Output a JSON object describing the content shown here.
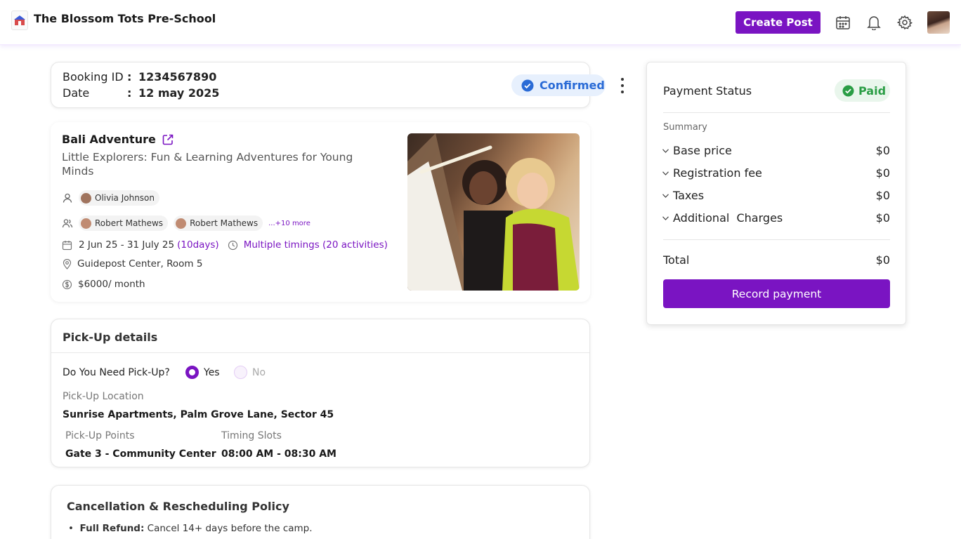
{
  "header": {
    "app_title": "The Blossom Tots Pre-School",
    "create_post_label": "Create Post"
  },
  "booking": {
    "id_label": "Booking ID",
    "id_value": "1234567890",
    "date_label": "Date",
    "date_value": "12 may 2025",
    "colon": ":",
    "status": "Confirmed"
  },
  "program": {
    "title": "Bali Adventure",
    "subtitle": "Little Explorers: Fun & Learning Adventures for Young Minds",
    "instructor": "Olivia Johnson",
    "participants": [
      "Robert Mathews",
      "Robert Mathews"
    ],
    "more_label": "...+10 more",
    "dates": "2 Jun 25 - 31 July 25",
    "duration": "(10days)",
    "timings": "Multiple timings (20 activities)",
    "location": "Guidepost Center, Room 5",
    "price": "$6000/ month"
  },
  "pickup": {
    "heading": "Pick-Up details",
    "question": "Do You Need Pick-Up?",
    "option_yes": "Yes",
    "option_no": "No",
    "selected": "Yes",
    "location_label": "Pick-Up Location",
    "location_value": "Sunrise Apartments, Palm Grove Lane, Sector 45",
    "points_label": "Pick-Up Points",
    "points_value": "Gate 3 - Community Center",
    "slots_label": "Timing Slots",
    "slots_value": "08:00 AM - 08:30 AM"
  },
  "policy": {
    "heading": "Cancellation & Rescheduling Policy",
    "item_bold": "Full Refund:",
    "item_text": "Cancel 14+ days before the camp."
  },
  "payment": {
    "status_label": "Payment Status",
    "status_value": "Paid",
    "summary_label": "Summary",
    "rows": [
      {
        "label": "Base price",
        "value": "$0"
      },
      {
        "label": "Registration fee",
        "value": "$0"
      },
      {
        "label": "Taxes",
        "value": "$0"
      },
      {
        "label": "Additional  Charges",
        "value": "$0"
      }
    ],
    "total_label": "Total",
    "total_value": "$0",
    "record_button": "Record payment"
  },
  "colors": {
    "brand": "#7a14c2",
    "confirmed": "#2a6bd6",
    "paid": "#2a9d45"
  },
  "icons": [
    "school-logo-icon",
    "calendar-icon",
    "bell-icon",
    "gear-icon",
    "check-circle-icon",
    "kebab-menu-icon",
    "external-link-icon",
    "person-icon",
    "group-icon",
    "date-icon",
    "clock-icon",
    "location-pin-icon",
    "dollar-icon",
    "chevron-down-icon"
  ]
}
